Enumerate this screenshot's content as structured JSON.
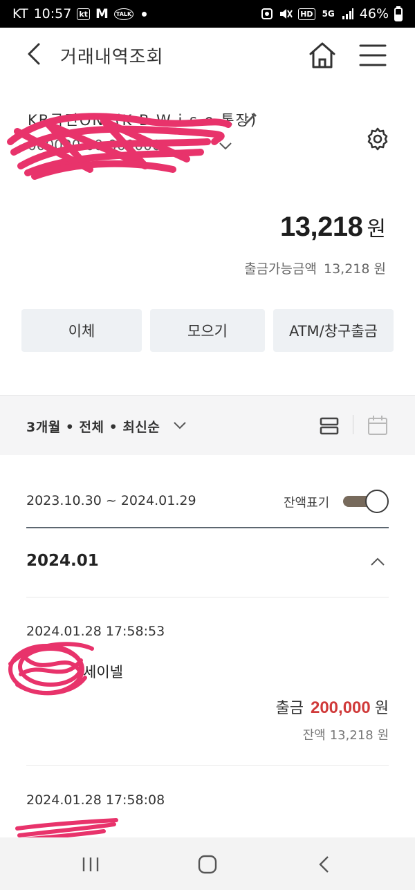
{
  "status_bar": {
    "carrier": "KT",
    "time": "10:57",
    "notif_icons": [
      "kt",
      "M",
      "TALK"
    ],
    "right_icons": [
      "HD",
      "5G"
    ],
    "battery": "46%"
  },
  "header": {
    "title": "거래내역조회"
  },
  "account": {
    "name_visible": "(K B W i s e 통장)",
    "balance": "13,218",
    "balance_unit": "원",
    "available_label": "출금가능금액",
    "available_amount": "13,218 원"
  },
  "actions": {
    "transfer": "이체",
    "save": "모으기",
    "atm": "ATM/창구출금"
  },
  "filter": {
    "label": "3개월 • 전체 • 최신순"
  },
  "period": {
    "range": "2023.10.30 ~ 2024.01.29",
    "show_balance_label": "잔액표기",
    "show_balance": true
  },
  "month_group": {
    "label": "2024.01"
  },
  "transactions": [
    {
      "datetime": "2024.01.28 17:58:53",
      "name": "세이넬",
      "type": "출금",
      "amount": "200,000",
      "unit": "원",
      "balance_label": "잔액",
      "balance": "13,218 원"
    },
    {
      "datetime": "2024.01.28 17:58:08"
    }
  ],
  "colors": {
    "withdraw_amount": "#d03a3a",
    "toggle_track": "#776a5c",
    "button_bg": "#eef1f4",
    "redaction": "#e8336b"
  }
}
